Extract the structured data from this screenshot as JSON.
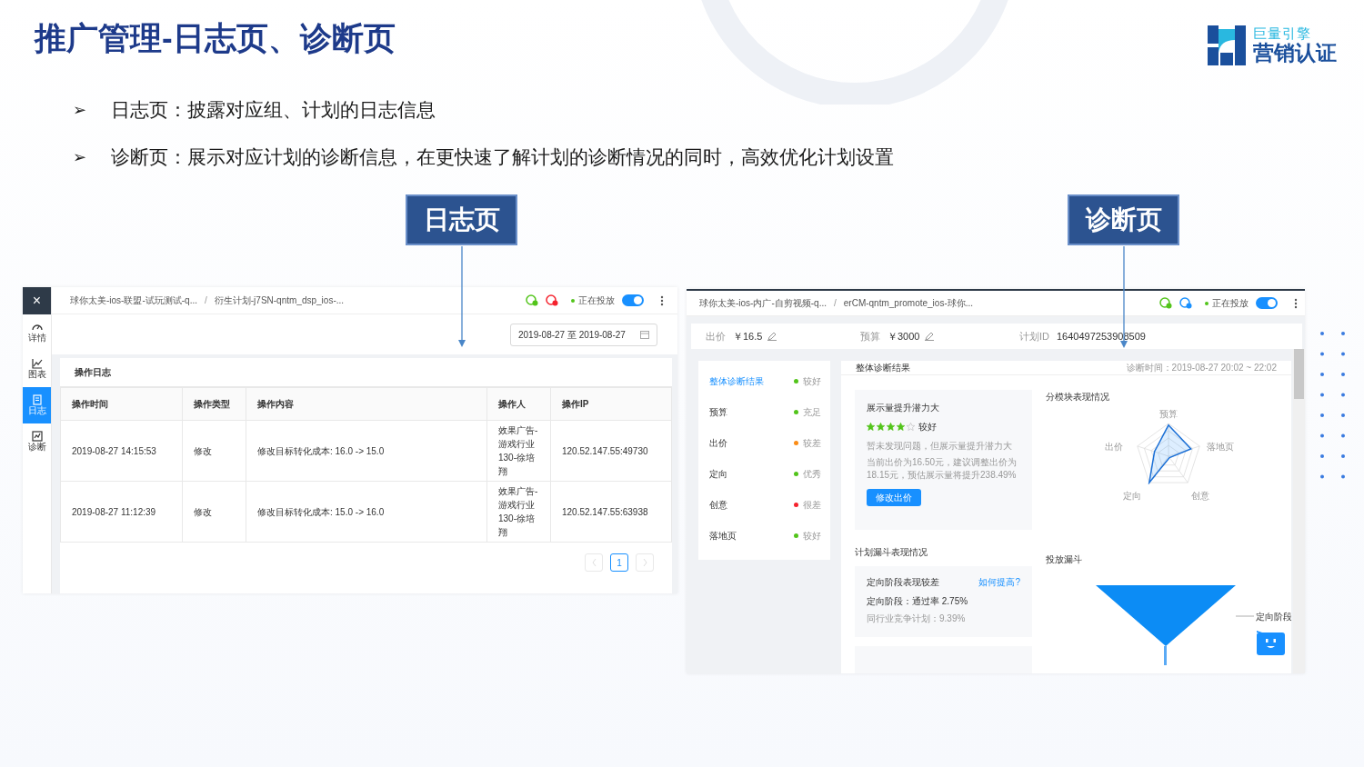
{
  "slide": {
    "title": "推广管理-日志页、诊断页",
    "logo": {
      "line1": "巨量引擎",
      "line2": "营销认证"
    },
    "bullets": [
      {
        "marker": "➢",
        "text": "日志页：披露对应组、计划的日志信息"
      },
      {
        "marker": "➢",
        "text": "诊断页：展示对应计划的诊断信息，在更快速了解计划的诊断情况的同时，高效优化计划设置"
      }
    ],
    "callouts": [
      "日志页",
      "诊断页"
    ]
  },
  "log_screen": {
    "close": "×",
    "sidebar": [
      {
        "kind": "gauge",
        "label": "详情",
        "selected": false
      },
      {
        "kind": "chart",
        "label": "图表",
        "selected": false
      },
      {
        "kind": "doc",
        "label": "日志",
        "selected": true
      },
      {
        "kind": "trend",
        "label": "诊断",
        "selected": false
      }
    ],
    "breadcrumb": [
      "球你太美-ios-联盟-试玩测试-q...",
      "衍生计划-j7SN-qntm_dsp_ios-..."
    ],
    "separator": "/",
    "status": "正在投放",
    "toggle_on": true,
    "date_range": "2019-08-27 至 2019-08-27",
    "card_title": "操作日志",
    "columns": [
      "操作时间",
      "操作类型",
      "操作内容",
      "操作人",
      "操作IP"
    ],
    "rows": [
      [
        "2019-08-27 14:15:53",
        "修改",
        "修改目标转化成本: 16.0 -> 15.0",
        "效果广告-游戏行业130-徐培翔",
        "120.52.147.55:49730"
      ],
      [
        "2019-08-27 11:12:39",
        "修改",
        "修改目标转化成本: 15.0 -> 16.0",
        "效果广告-游戏行业130-徐培翔",
        "120.52.147.55:63938"
      ]
    ],
    "pages": [
      {
        "label": "1",
        "selected": true
      }
    ]
  },
  "diag_screen": {
    "breadcrumb": [
      "球你太美-ios-内广-自剪视频-q...",
      "erCM-qntm_promote_ios-球你..."
    ],
    "separator": "/",
    "status": "正在投放",
    "toggle_on": true,
    "metrics": [
      {
        "label": "出价",
        "value": "￥16.5",
        "editable": true
      },
      {
        "label": "预算",
        "value": "￥3000",
        "editable": true
      },
      {
        "label": "计划ID",
        "value": "1640497253908509",
        "editable": false
      }
    ],
    "nav": [
      {
        "label": "整体诊断结果",
        "status": "较好",
        "color": "#52c41a",
        "selected": true
      },
      {
        "label": "预算",
        "status": "充足",
        "color": "#52c41a",
        "selected": false
      },
      {
        "label": "出价",
        "status": "较差",
        "color": "#fa8c16",
        "selected": false
      },
      {
        "label": "定向",
        "status": "优秀",
        "color": "#52c41a",
        "selected": false
      },
      {
        "label": "创意",
        "status": "很差",
        "color": "#f5222d",
        "selected": false
      },
      {
        "label": "落地页",
        "status": "较好",
        "color": "#52c41a",
        "selected": false
      }
    ],
    "panel_title": "整体诊断结果",
    "diagnosis_time": "诊断时间：2019-08-27 20:02 ~ 22:02",
    "insight": {
      "title": "展示量提升潜力大",
      "stars": 4,
      "rating": "较好",
      "note": "暂未发现问题，但展示量提升潜力大",
      "advice": "当前出价为16.50元，建议调整出价为18.15元，预估展示量将提升238.49%",
      "button": "修改出价"
    },
    "module_title": "分模块表现情况",
    "radar_labels": [
      "预算",
      "落地页",
      "创意",
      "定向",
      "出价"
    ],
    "funnel_title": "计划漏斗表现情况",
    "stage_card": {
      "title": "定向阶段表现较差",
      "link": "如何提高?",
      "line": "定向阶段：通过率 2.75%",
      "peer": "同行业竞争计划：9.39%"
    },
    "delivery_title": "投放漏斗",
    "funnel_label": "定向阶段"
  }
}
